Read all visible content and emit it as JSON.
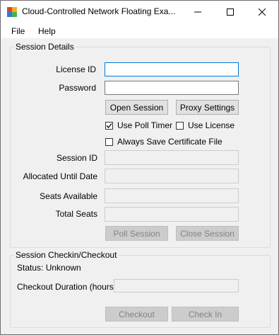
{
  "window": {
    "title": "Cloud-Controlled Network Floating Exa..."
  },
  "menu": {
    "file": "File",
    "help": "Help"
  },
  "session_details": {
    "title": "Session Details",
    "license_id_label": "License ID",
    "license_id_value": "",
    "password_label": "Password",
    "password_value": "",
    "open_session": "Open Session",
    "proxy_settings": "Proxy Settings",
    "use_poll_timer": "Use Poll Timer",
    "use_poll_timer_checked": true,
    "use_license": "Use License",
    "use_license_checked": false,
    "always_save_cert": "Always Save Certificate File",
    "always_save_cert_checked": false,
    "session_id_label": "Session ID",
    "allocated_until_label": "Allocated Until Date",
    "seats_available_label": "Seats Available",
    "total_seats_label": "Total Seats",
    "poll_session": "Poll Session",
    "close_session": "Close Session"
  },
  "checkout": {
    "title": "Session Checkin/Checkout",
    "status": "Status: Unknown",
    "duration_label": "Checkout Duration (hours):",
    "checkout_button": "Checkout",
    "checkin_button": "Check In"
  }
}
